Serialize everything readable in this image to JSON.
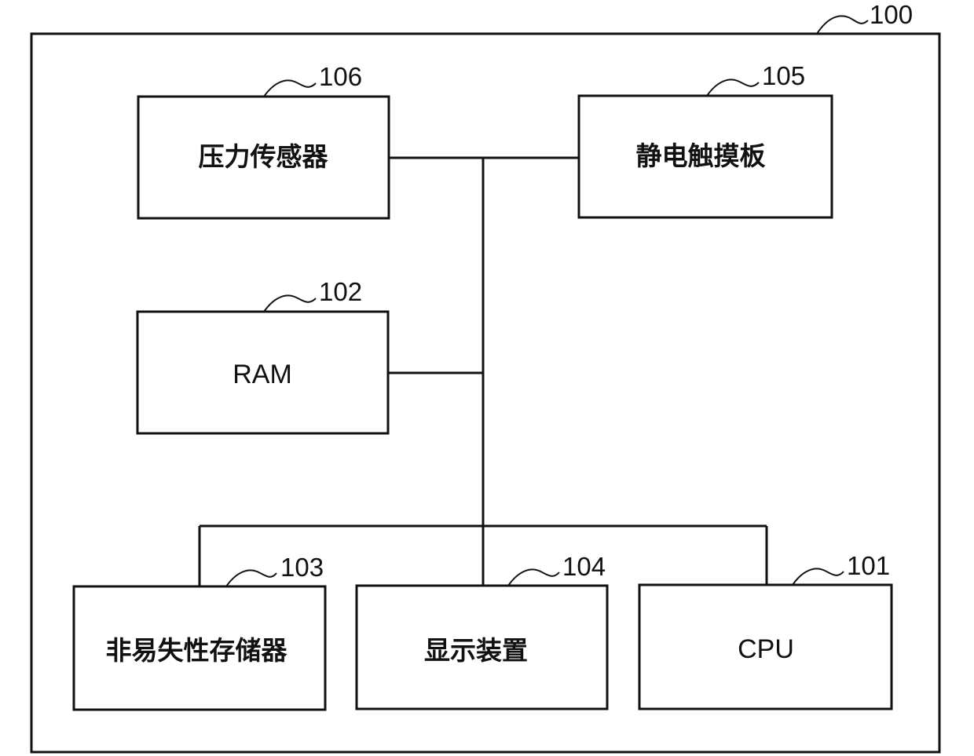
{
  "figure": {
    "outer_ref": "100",
    "blocks": {
      "pressure_sensor": {
        "ref": "106",
        "label": "压力传感器"
      },
      "touch_panel": {
        "ref": "105",
        "label": "静电触摸板"
      },
      "ram": {
        "ref": "102",
        "label": "RAM"
      },
      "nonvolatile_storage": {
        "ref": "103",
        "label": "非易失性存储器"
      },
      "display_device": {
        "ref": "104",
        "label": "显示装置"
      },
      "cpu": {
        "ref": "101",
        "label": "CPU"
      }
    },
    "connections": [
      [
        "pressure_sensor",
        "bus"
      ],
      [
        "touch_panel",
        "bus"
      ],
      [
        "ram",
        "bus"
      ],
      [
        "bus",
        "nonvolatile_storage"
      ],
      [
        "bus",
        "display_device"
      ],
      [
        "bus",
        "cpu"
      ]
    ]
  }
}
